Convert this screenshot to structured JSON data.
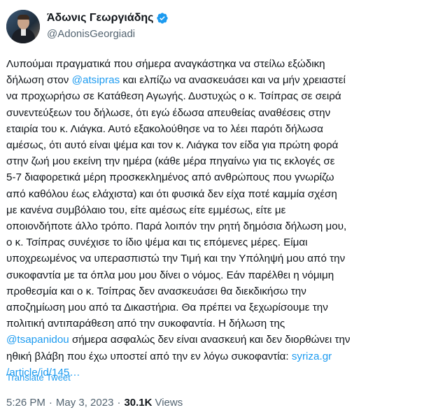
{
  "author": {
    "display_name": "Άδωνις Γεωργιάδης",
    "handle": "@AdonisGeorgiadi",
    "verified_color": "#1d9bf0"
  },
  "tweet": {
    "segments": [
      {
        "type": "text",
        "value": "Λυπούμαι πραγματικά που σήμερα αναγκάστηκα να στείλω εξώδικη\nδήλωση στον "
      },
      {
        "type": "mention",
        "value": "@atsipras"
      },
      {
        "type": "text",
        "value": " και ελπίζω να ανασκευάσει και να μήν χρειαστεί\nνα προχωρήσω σε Κατάθεση Αγωγής. Δυστυχώς ο κ. Τσίπρας σε σειρά\nσυνεντεύξεων του δήλωσε, ότι εγώ έδωσα απευθείας αναθέσεις στην\nεταιρία του κ. Λιάγκα. Αυτό εξακολούθησε να το λέει παρότι δήλωσα\nαμέσως, ότι αυτό είναι ψέμα και τον κ. Λιάγκα τον είδα για πρώτη φορά\nστην ζωή μου εκείνη την ημέρα (κάθε μέρα πηγαίνω για τις εκλογές σε\n5-7 διαφορετικά μέρη προσκεκλημένος από ανθρώπους που γνωρίζω\nαπό καθόλου έως ελάχιστα) και ότι φυσικά δεν είχα ποτέ καμμία σχέση\nμε κανένα συμβόλαιο του, είτε αμέσως είτε εμμέσως, είτε με\nοποιονδήποτε άλλο τρόπο. Παρά λοιπόν την ρητή δημόσια δήλωση μου,\nο κ. Τσίπρας συνέχισε το ίδιο ψέμα και τις επόμενες μέρες. Είμαι\nυποχρεωμένος να υπερασπιστώ την Τιμή και την Υπόληψή μου από την\nσυκοφαντία με τα όπλα μου μου δίνει ο νόμος. Εάν παρέλθει η νόμιμη\nπροθεσμία και ο κ. Τσίπρας δεν ανασκευάσει θα διεκδικήσω την\nαποζημίωση μου από τα Δικαστήρια. Θα πρέπει να ξεχωρίσουμε την\nπολιτική αντιπαράθεση από την συκοφαντία. Η δήλωση της\n"
      },
      {
        "type": "mention",
        "value": "@tsapanidou"
      },
      {
        "type": "text",
        "value": " σήμερα ασφαλώς δεν είναι ανασκευή και δεν διορθώνει την\nηθική βλάβη που έχω υποστεί από την εν λόγω συκοφαντία: "
      },
      {
        "type": "link",
        "value": "syriza.gr\n/article/id/145…"
      }
    ],
    "translate_label": "Translate Tweet",
    "time": "5:26 PM",
    "separator": "·",
    "date": "May 3, 2023",
    "views_count": "30.1K",
    "views_label": "Views"
  }
}
